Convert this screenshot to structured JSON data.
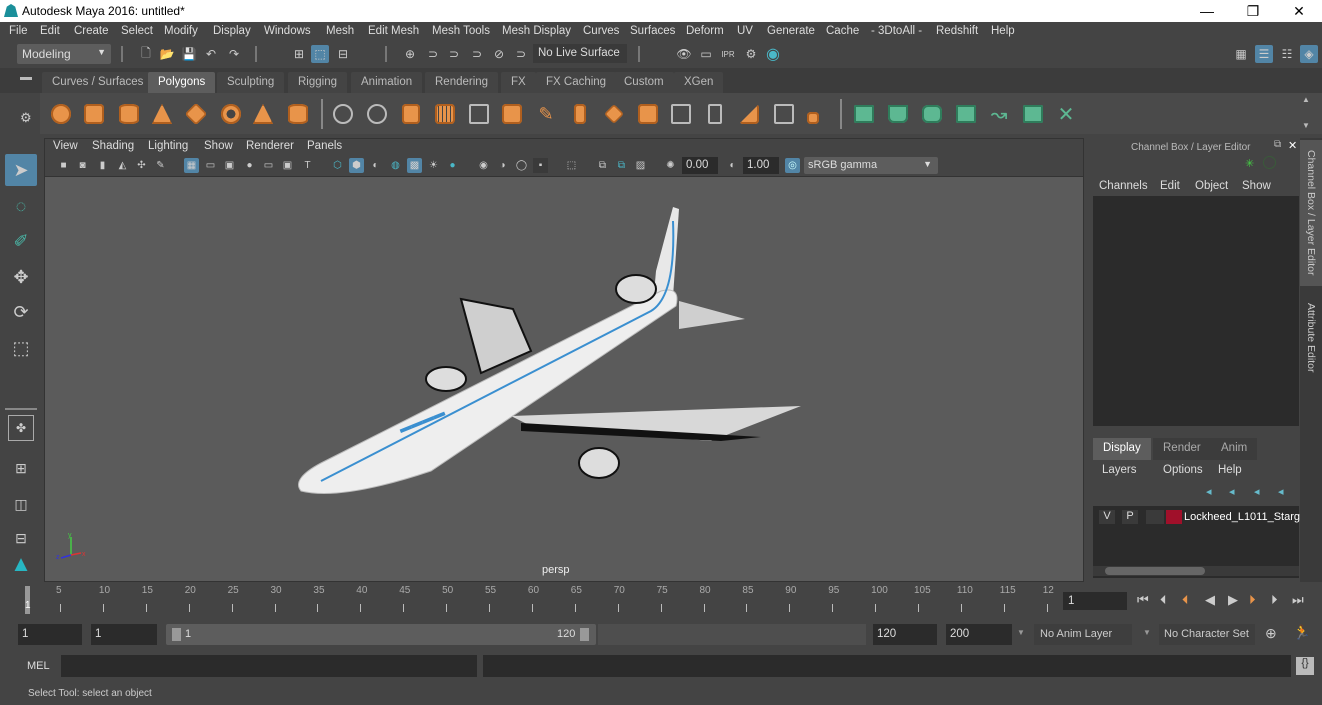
{
  "window": {
    "title": "Autodesk Maya 2016: untitled*",
    "minimize": "—",
    "maximize": "❐",
    "close": "✕"
  },
  "menubar": [
    "File",
    "Edit",
    "Create",
    "Select",
    "Modify",
    "Display",
    "Windows",
    "Mesh",
    "Edit Mesh",
    "Mesh Tools",
    "Mesh Display",
    "Curves",
    "Surfaces",
    "Deform",
    "UV",
    "Generate",
    "Cache",
    "- 3DtoAll -",
    "Redshift",
    "Help"
  ],
  "statusline": {
    "menuset": "Modeling",
    "live_surface": "No Live Surface"
  },
  "shelf_tabs": [
    {
      "label": "Curves / Surfaces",
      "active": false
    },
    {
      "label": "Polygons",
      "active": true
    },
    {
      "label": "Sculpting",
      "active": false
    },
    {
      "label": "Rigging",
      "active": false
    },
    {
      "label": "Animation",
      "active": false
    },
    {
      "label": "Rendering",
      "active": false
    },
    {
      "label": "FX",
      "active": false
    },
    {
      "label": "FX Caching",
      "active": false
    },
    {
      "label": "Custom",
      "active": false
    },
    {
      "label": "XGen",
      "active": false
    }
  ],
  "shelf_icons": [
    "poly-sphere",
    "poly-cube",
    "poly-cylinder",
    "poly-cone",
    "poly-plane",
    "poly-torus",
    "poly-pyramid",
    "poly-pipe",
    "combine",
    "separate",
    "mirror",
    "smooth",
    "extract",
    "booleans",
    "multi-cut",
    "extrude",
    "bridge",
    "append",
    "bevel",
    "fill-hole",
    "merge",
    "target-weld",
    "insert-edge-loop",
    "planar-uv",
    "cylindrical-uv",
    "spherical-uv",
    "automatic-uv",
    "unfold-uv",
    "uv-editor",
    "layout-uv"
  ],
  "viewport": {
    "menu": [
      "View",
      "Shading",
      "Lighting",
      "Show",
      "Renderer",
      "Panels"
    ],
    "exposure": "0.00",
    "gamma": "1.00",
    "color_space": "sRGB gamma",
    "camera_label": "persp",
    "axis": {
      "x": "x",
      "y": "y",
      "z": "z"
    }
  },
  "channel_box": {
    "title": "Channel Box / Layer Editor",
    "menu": [
      "Channels",
      "Edit",
      "Object",
      "Show"
    ]
  },
  "layer_editor": {
    "tabs": [
      {
        "label": "Display",
        "active": true
      },
      {
        "label": "Render",
        "active": false
      },
      {
        "label": "Anim",
        "active": false
      }
    ],
    "menu": [
      "Layers",
      "Options",
      "Help"
    ],
    "layers": [
      {
        "visible": "V",
        "playback": "P",
        "color": "#a0102a",
        "name": "Lockheed_L1011_Starg"
      }
    ]
  },
  "side_tabs": [
    "Channel Box / Layer Editor",
    "Attribute Editor"
  ],
  "timeline": {
    "ticks": [
      "5",
      "10",
      "15",
      "20",
      "25",
      "30",
      "35",
      "40",
      "45",
      "50",
      "55",
      "60",
      "65",
      "70",
      "75",
      "80",
      "85",
      "90",
      "95",
      "100",
      "105",
      "110",
      "115",
      "12"
    ],
    "current_marker": "1",
    "current_frame": "1"
  },
  "range": {
    "start": "1",
    "playback_start": "1",
    "slider_start": "1",
    "slider_end": "120",
    "playback_end": "120",
    "end": "200",
    "anim_layer": "No Anim Layer",
    "character_set": "No Character Set"
  },
  "command_line": {
    "label": "MEL"
  },
  "help_line": "Select Tool: select an object"
}
